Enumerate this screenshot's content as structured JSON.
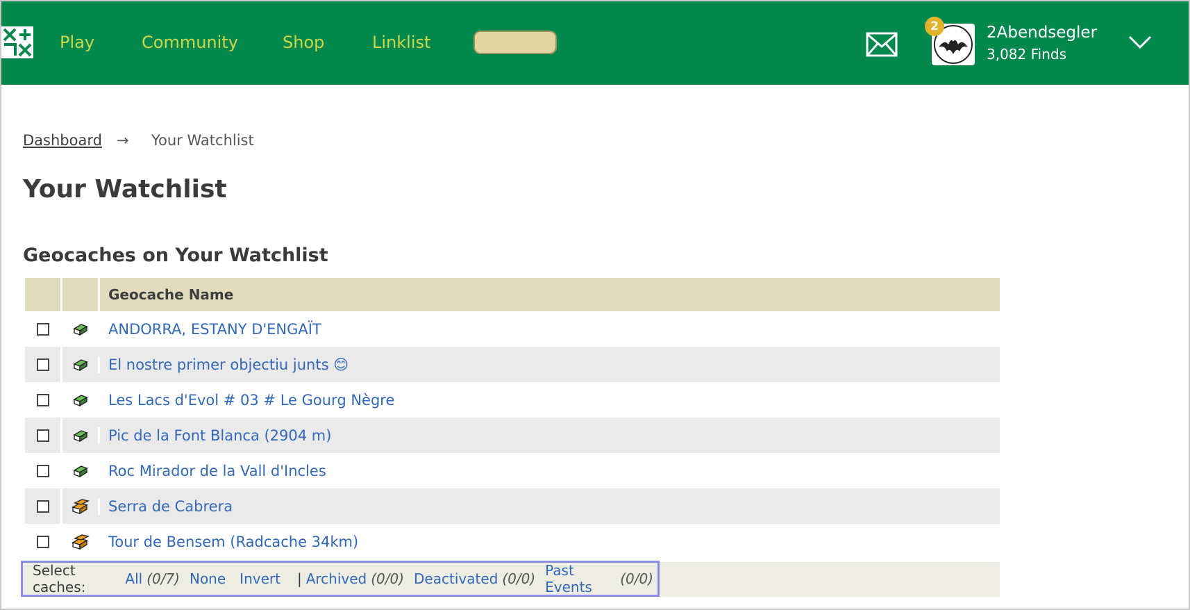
{
  "header": {
    "nav": [
      "Play",
      "Community",
      "Shop",
      "Linklist"
    ],
    "notification_count": "2",
    "username": "2Abendsegler",
    "finds": "3,082 Finds"
  },
  "breadcrumb": {
    "link": "Dashboard",
    "arrow": "→",
    "current": "Your Watchlist"
  },
  "page_title": "Your Watchlist",
  "section_title": "Geocaches on Your Watchlist",
  "table": {
    "column_header": "Geocache Name",
    "rows": [
      {
        "name": "ANDORRA, ESTANY D'ENGAÏT",
        "type_icon": "traditional-cache-icon"
      },
      {
        "name": "El nostre primer objectiu junts 😊",
        "type_icon": "traditional-cache-icon"
      },
      {
        "name": "Les Lacs d'Evol # 03 # Le Gourg Nègre",
        "type_icon": "traditional-cache-icon"
      },
      {
        "name": "Pic de la Font Blanca (2904 m)",
        "type_icon": "traditional-cache-icon"
      },
      {
        "name": "Roc Mirador de la Vall d'Incles",
        "type_icon": "traditional-cache-icon"
      },
      {
        "name": "Serra de Cabrera",
        "type_icon": "multi-cache-icon"
      },
      {
        "name": "Tour de Bensem (Radcache 34km)",
        "type_icon": "multi-cache-icon"
      }
    ]
  },
  "select_bar": {
    "label": "Select caches:",
    "all": "All",
    "all_count": "(0/7)",
    "none": "None",
    "invert": "Invert",
    "pipe": "|",
    "archived": "Archived",
    "archived_count": "(0/0)",
    "deactivated": "Deactivated",
    "deactivated_count": "(0/0)",
    "past_events": "Past Events",
    "past_events_count": "(0/0)"
  },
  "colors": {
    "header_green": "#02874d",
    "nav_text": "#cbd84a",
    "link_blue": "#3168b8",
    "table_header": "#e2dcbf",
    "badge": "#e0b32a"
  }
}
